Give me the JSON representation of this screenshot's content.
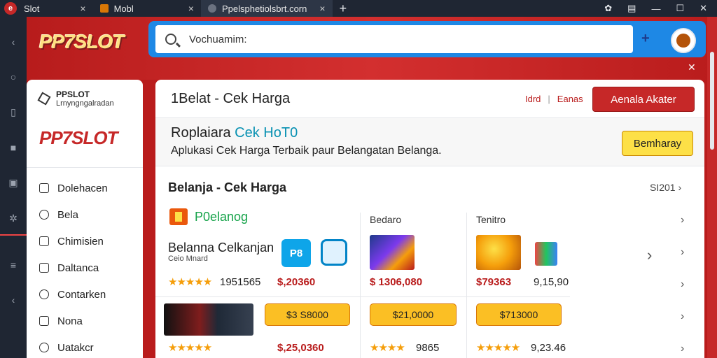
{
  "browser": {
    "tabs": [
      {
        "label": "Slot",
        "close": "×"
      },
      {
        "label": "Mobl",
        "close": "×"
      },
      {
        "label": "Ppelsphetiolsbrt.corn",
        "close": "×"
      }
    ],
    "new_tab": "+"
  },
  "header": {
    "logo": "PP7SLOT",
    "search_placeholder": "Vochuamim:",
    "plus_icon": "+"
  },
  "sidebar": {
    "brand_title": "PPSLOT",
    "brand_subtitle": "Lrnyngngalradan",
    "logo": "PP7SLOT",
    "items": [
      {
        "label": "Dolehacen",
        "icon": "calendar-icon"
      },
      {
        "label": "Bela",
        "icon": "clock-icon"
      },
      {
        "label": "Chimisien",
        "icon": "square-icon"
      },
      {
        "label": "Daltanca",
        "icon": "image-icon"
      },
      {
        "label": "Contarken",
        "icon": "lock-icon"
      },
      {
        "label": "Nona",
        "icon": "tag-icon"
      },
      {
        "label": "Uatakcr",
        "icon": "user-icon"
      }
    ]
  },
  "main": {
    "title": "1Belat - Cek Harga",
    "top_link1": "Idrd",
    "top_link2": "Eanas",
    "alert_button": "Aenala Akater",
    "promo": {
      "title_part1": "Roplaiara",
      "title_part2": "Cek HoT0",
      "subtitle": "Aplukasi Cek Harga Terbaik paur Belangatan Belanga.",
      "button": "Bemharay"
    },
    "section": {
      "title": "Belanja - Cek Harga",
      "more": "SI201"
    },
    "columns": {
      "col1_category": "P0elanog",
      "col2_label": "Bedaro",
      "col3_label": "Tenitro"
    },
    "product": {
      "name": "Belanna Celkanjan",
      "sub": "Ceio Mnard",
      "icon_label": "P8"
    },
    "row1": {
      "c1_stars": "★★★★★",
      "c1_rating": "1951565",
      "c1_price": "$,20360",
      "c2_price": "$ 1306,080",
      "c3_price": "$79363",
      "c3_extra": "9,15,90"
    },
    "row2": {
      "c1_button": "$3 S8000",
      "c1_stars": "★★★★★",
      "c1_price": "$,25,0360",
      "c2_button": "$21,0000",
      "c2_stars": "★★★★",
      "c2_rating": "9865",
      "c3_button": "$713000",
      "c3_stars": "★★★★★",
      "c3_rating": "9,23.46"
    }
  }
}
